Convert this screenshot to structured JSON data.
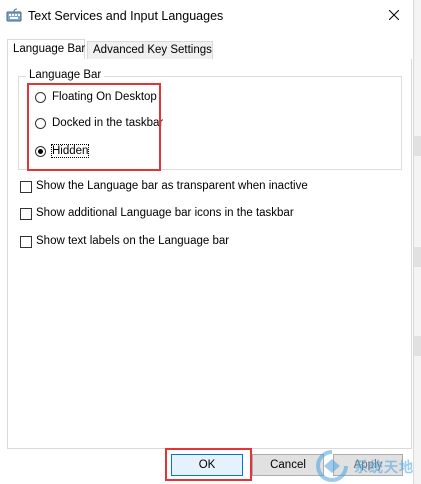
{
  "window": {
    "title": "Text Services and Input Languages"
  },
  "tabs": [
    {
      "label": "Language Bar",
      "active": true
    },
    {
      "label": "Advanced Key Settings",
      "active": false
    }
  ],
  "language_bar_group": {
    "legend": "Language Bar",
    "options": [
      {
        "label": "Floating On Desktop",
        "checked": false
      },
      {
        "label": "Docked in the taskbar",
        "checked": false
      },
      {
        "label": "Hidden",
        "checked": true
      }
    ]
  },
  "checkboxes": [
    {
      "label": "Show the Language bar as transparent when inactive",
      "checked": false
    },
    {
      "label": "Show additional Language bar icons in the taskbar",
      "checked": false
    },
    {
      "label": "Show text labels on the Language bar",
      "checked": false
    }
  ],
  "buttons": {
    "ok": "OK",
    "cancel": "Cancel",
    "apply": "Apply"
  },
  "watermark": {
    "text": "系统天地"
  },
  "colors": {
    "highlight": "#e0363a",
    "ok_border": "#0078d7"
  }
}
